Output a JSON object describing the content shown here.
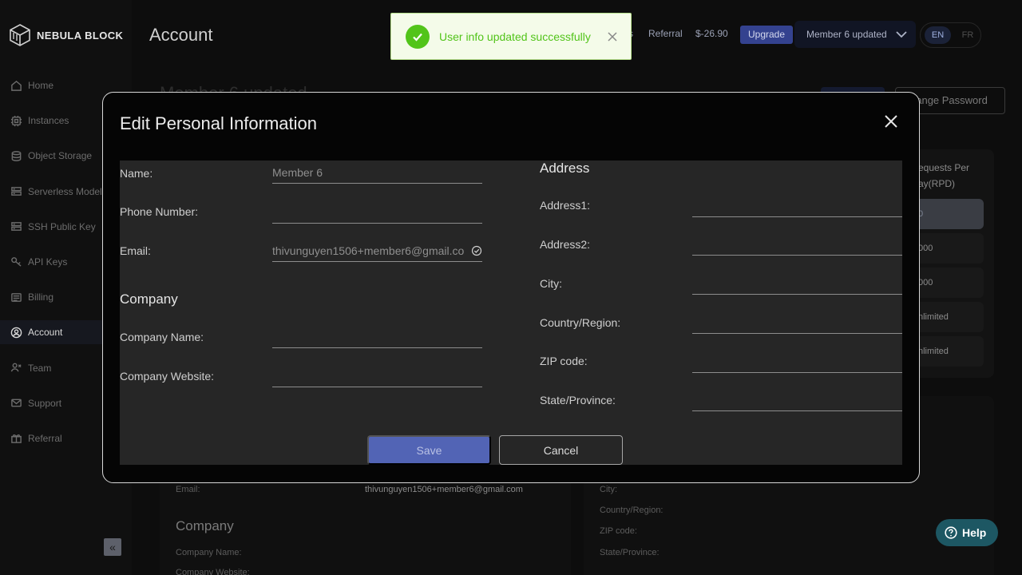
{
  "app": {
    "brand": "NEBULA BLOCK",
    "page_title": "Account"
  },
  "sidebar": {
    "items": [
      {
        "label": "Home",
        "icon": "home-icon"
      },
      {
        "label": "Instances",
        "icon": "cpu-icon"
      },
      {
        "label": "Object Storage",
        "icon": "database-icon"
      },
      {
        "label": "Serverless Models",
        "icon": "server-icon"
      },
      {
        "label": "SSH Public Key",
        "icon": "server-key-icon"
      },
      {
        "label": "API Keys",
        "icon": "key-icon"
      },
      {
        "label": "Billing",
        "icon": "billing-icon"
      },
      {
        "label": "Account",
        "icon": "account-icon",
        "active": true
      },
      {
        "label": "Team",
        "icon": "team-icon"
      },
      {
        "label": "Support",
        "icon": "mail-icon"
      },
      {
        "label": "Referral",
        "icon": "gift-icon"
      }
    ],
    "collapse_glyph": "«"
  },
  "header": {
    "partial_link": "s",
    "referral_label": "Referral",
    "balance": "$-26.90",
    "upgrade_label": "Upgrade",
    "user_name": "Member 6 updated",
    "lang_active": "EN",
    "lang_inactive": "FR"
  },
  "toast": {
    "message": "User info updated successfully",
    "status_color": "#52c41a"
  },
  "background": {
    "member_title": "Member 6 updated",
    "change_password_label": "hange Password",
    "table_header": "equests Per\nay(RPD)",
    "table_rows": [
      "0",
      "000",
      "000",
      "nlimited",
      "nlimited"
    ],
    "company_heading": "Company",
    "email_label": "Email:",
    "email_value": "thivunguyen1506+member6@gmail.com",
    "company_name_label": "Company Name:",
    "company_website_label": "Company Website:",
    "city_label": "City:",
    "country_label": "Country/Region:",
    "zip_label": "ZIP code:",
    "state_label": "State/Province:"
  },
  "modal": {
    "title": "Edit Personal Information",
    "left": {
      "name_label": "Name:",
      "name_value": "Member 6",
      "phone_label": "Phone Number:",
      "phone_value": "",
      "email_label": "Email:",
      "email_value": "thivunguyen1506+member6@gmail.co",
      "company_heading": "Company",
      "company_name_label": "Company Name:",
      "company_name_value": "",
      "company_website_label": "Company Website:",
      "company_website_value": ""
    },
    "right": {
      "address_heading": "Address",
      "address1_label": "Address1:",
      "address2_label": "Address2:",
      "city_label": "City:",
      "country_label": "Country/Region:",
      "zip_label": "ZIP code:",
      "state_label": "State/Province:"
    },
    "save_label": "Save",
    "cancel_label": "Cancel"
  },
  "help": {
    "label": "Help"
  },
  "colors": {
    "accent": "#5264b5",
    "upgrade": "#34428f",
    "help": "#1d5763",
    "success": "#52c41a"
  }
}
